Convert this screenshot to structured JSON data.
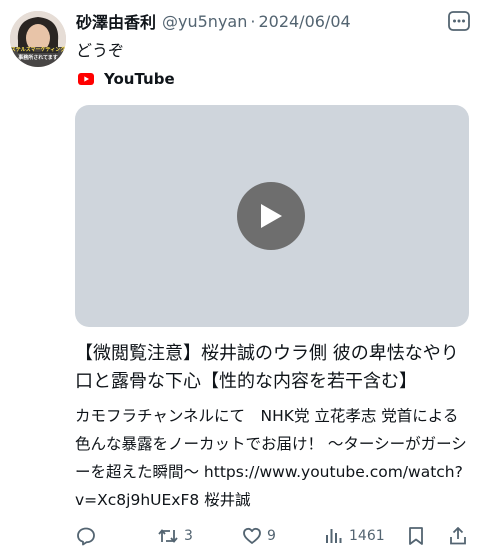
{
  "tweet": {
    "author_name": "砂澤由香利",
    "handle": "@yu5nyan",
    "separator": "·",
    "date": "2024/06/04",
    "text": "どうぞ",
    "avatar_caption_1": "ステルスマーケティング",
    "avatar_caption_2": "事務所されてます"
  },
  "card": {
    "source": "YouTube",
    "title": "【微閲覧注意】桜井誠のウラ側 彼の卑怯なやり口と露骨な下心【性的な内容を若干含む】",
    "description": "カモフラチャンネルにて　NHK党 立花孝志 党首による色んな暴露をノーカットでお届け！ 〜ターシーがガーシーを超えた瞬間〜 https://www.youtube.com/watch?v=Xc8j9hUExF8 桜井誠"
  },
  "actions": {
    "reply_count": "",
    "retweet_count": "3",
    "like_count": "9",
    "view_count": "1461"
  },
  "colors": {
    "text": "#0f1419",
    "muted": "#536471",
    "youtube_red": "#ff0000",
    "video_placeholder": "#cfd5dc",
    "play_button": "#6e6e6e"
  }
}
